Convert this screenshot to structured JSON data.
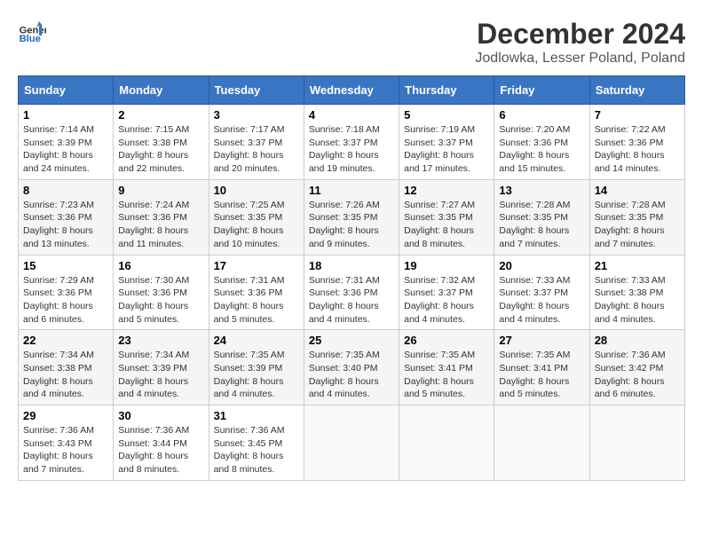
{
  "header": {
    "logo_general": "General",
    "logo_blue": "Blue",
    "title": "December 2024",
    "subtitle": "Jodlowka, Lesser Poland, Poland"
  },
  "calendar": {
    "days_of_week": [
      "Sunday",
      "Monday",
      "Tuesday",
      "Wednesday",
      "Thursday",
      "Friday",
      "Saturday"
    ],
    "weeks": [
      [
        {
          "day": "1",
          "sunrise": "7:14 AM",
          "sunset": "3:39 PM",
          "daylight": "8 hours and 24 minutes."
        },
        {
          "day": "2",
          "sunrise": "7:15 AM",
          "sunset": "3:38 PM",
          "daylight": "8 hours and 22 minutes."
        },
        {
          "day": "3",
          "sunrise": "7:17 AM",
          "sunset": "3:37 PM",
          "daylight": "8 hours and 20 minutes."
        },
        {
          "day": "4",
          "sunrise": "7:18 AM",
          "sunset": "3:37 PM",
          "daylight": "8 hours and 19 minutes."
        },
        {
          "day": "5",
          "sunrise": "7:19 AM",
          "sunset": "3:37 PM",
          "daylight": "8 hours and 17 minutes."
        },
        {
          "day": "6",
          "sunrise": "7:20 AM",
          "sunset": "3:36 PM",
          "daylight": "8 hours and 15 minutes."
        },
        {
          "day": "7",
          "sunrise": "7:22 AM",
          "sunset": "3:36 PM",
          "daylight": "8 hours and 14 minutes."
        }
      ],
      [
        {
          "day": "8",
          "sunrise": "7:23 AM",
          "sunset": "3:36 PM",
          "daylight": "8 hours and 13 minutes."
        },
        {
          "day": "9",
          "sunrise": "7:24 AM",
          "sunset": "3:36 PM",
          "daylight": "8 hours and 11 minutes."
        },
        {
          "day": "10",
          "sunrise": "7:25 AM",
          "sunset": "3:35 PM",
          "daylight": "8 hours and 10 minutes."
        },
        {
          "day": "11",
          "sunrise": "7:26 AM",
          "sunset": "3:35 PM",
          "daylight": "8 hours and 9 minutes."
        },
        {
          "day": "12",
          "sunrise": "7:27 AM",
          "sunset": "3:35 PM",
          "daylight": "8 hours and 8 minutes."
        },
        {
          "day": "13",
          "sunrise": "7:28 AM",
          "sunset": "3:35 PM",
          "daylight": "8 hours and 7 minutes."
        },
        {
          "day": "14",
          "sunrise": "7:28 AM",
          "sunset": "3:35 PM",
          "daylight": "8 hours and 7 minutes."
        }
      ],
      [
        {
          "day": "15",
          "sunrise": "7:29 AM",
          "sunset": "3:36 PM",
          "daylight": "8 hours and 6 minutes."
        },
        {
          "day": "16",
          "sunrise": "7:30 AM",
          "sunset": "3:36 PM",
          "daylight": "8 hours and 5 minutes."
        },
        {
          "day": "17",
          "sunrise": "7:31 AM",
          "sunset": "3:36 PM",
          "daylight": "8 hours and 5 minutes."
        },
        {
          "day": "18",
          "sunrise": "7:31 AM",
          "sunset": "3:36 PM",
          "daylight": "8 hours and 4 minutes."
        },
        {
          "day": "19",
          "sunrise": "7:32 AM",
          "sunset": "3:37 PM",
          "daylight": "8 hours and 4 minutes."
        },
        {
          "day": "20",
          "sunrise": "7:33 AM",
          "sunset": "3:37 PM",
          "daylight": "8 hours and 4 minutes."
        },
        {
          "day": "21",
          "sunrise": "7:33 AM",
          "sunset": "3:38 PM",
          "daylight": "8 hours and 4 minutes."
        }
      ],
      [
        {
          "day": "22",
          "sunrise": "7:34 AM",
          "sunset": "3:38 PM",
          "daylight": "8 hours and 4 minutes."
        },
        {
          "day": "23",
          "sunrise": "7:34 AM",
          "sunset": "3:39 PM",
          "daylight": "8 hours and 4 minutes."
        },
        {
          "day": "24",
          "sunrise": "7:35 AM",
          "sunset": "3:39 PM",
          "daylight": "8 hours and 4 minutes."
        },
        {
          "day": "25",
          "sunrise": "7:35 AM",
          "sunset": "3:40 PM",
          "daylight": "8 hours and 4 minutes."
        },
        {
          "day": "26",
          "sunrise": "7:35 AM",
          "sunset": "3:41 PM",
          "daylight": "8 hours and 5 minutes."
        },
        {
          "day": "27",
          "sunrise": "7:35 AM",
          "sunset": "3:41 PM",
          "daylight": "8 hours and 5 minutes."
        },
        {
          "day": "28",
          "sunrise": "7:36 AM",
          "sunset": "3:42 PM",
          "daylight": "8 hours and 6 minutes."
        }
      ],
      [
        {
          "day": "29",
          "sunrise": "7:36 AM",
          "sunset": "3:43 PM",
          "daylight": "8 hours and 7 minutes."
        },
        {
          "day": "30",
          "sunrise": "7:36 AM",
          "sunset": "3:44 PM",
          "daylight": "8 hours and 8 minutes."
        },
        {
          "day": "31",
          "sunrise": "7:36 AM",
          "sunset": "3:45 PM",
          "daylight": "8 hours and 8 minutes."
        },
        null,
        null,
        null,
        null
      ]
    ],
    "labels": {
      "sunrise": "Sunrise:",
      "sunset": "Sunset:",
      "daylight": "Daylight hours"
    }
  }
}
